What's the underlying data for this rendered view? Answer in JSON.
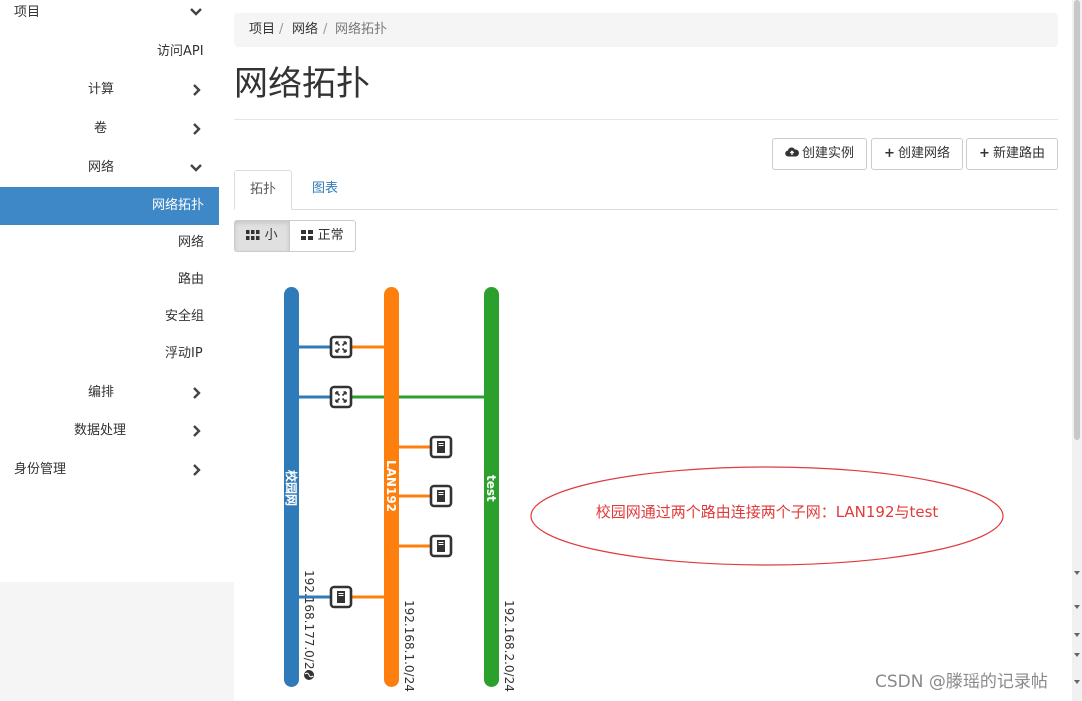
{
  "sidebar": {
    "project": "项目",
    "access_api": "访问API",
    "compute": "计算",
    "volumes": "卷",
    "network": "网络",
    "network_topology": "网络拓扑",
    "networks": "网络",
    "routers": "路由",
    "security_groups": "安全组",
    "floating_ips": "浮动IP",
    "orchestration": "编排",
    "data_processing": "数据处理",
    "identity": "身份管理"
  },
  "breadcrumb": {
    "item1": "项目",
    "item2": "网络",
    "item3": "网络拓扑"
  },
  "page_title": "网络拓扑",
  "actions": {
    "create_instance": "创建实例",
    "create_network": "创建网络",
    "create_router": "新建路由"
  },
  "tabs": {
    "topology": "拓扑",
    "graph": "图表"
  },
  "view_toggle": {
    "small": "小",
    "normal": "正常"
  },
  "topology": {
    "networks": [
      {
        "name": "校园网",
        "cidr": "192.168.177.0/24",
        "color": "#2f7ab8",
        "external": true
      },
      {
        "name": "LAN192",
        "cidr": "192.168.1.0/24",
        "color": "#ff7f0e"
      },
      {
        "name": "test",
        "cidr": "192.168.2.0/24",
        "color": "#2ca02c"
      }
    ]
  },
  "annotation": "校园网通过两个路由连接两个子网：LAN192与test",
  "watermark": "CSDN @滕瑶的记录帖",
  "colors": {
    "active_nav": "#3f88c8",
    "link": "#337ab7",
    "annotation": "#e03a3a"
  }
}
